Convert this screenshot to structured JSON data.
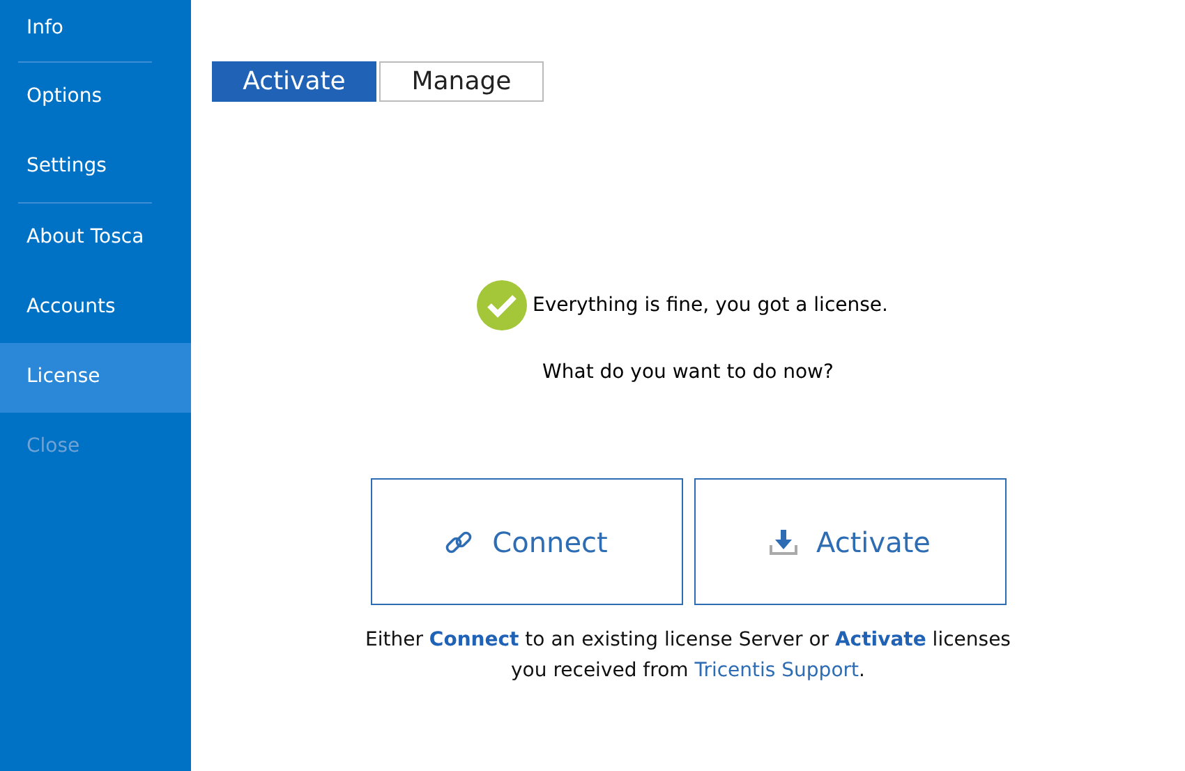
{
  "sidebar": {
    "items": [
      {
        "label": "Info",
        "selected": false,
        "disabled": false,
        "divider_after": true
      },
      {
        "label": "Options",
        "selected": false,
        "disabled": false,
        "divider_after": false
      },
      {
        "label": "Settings",
        "selected": false,
        "disabled": false,
        "divider_after": true
      },
      {
        "label": "About Tosca",
        "selected": false,
        "disabled": false,
        "divider_after": false
      },
      {
        "label": "Accounts",
        "selected": false,
        "disabled": false,
        "divider_after": false
      },
      {
        "label": "License",
        "selected": true,
        "disabled": false,
        "divider_after": false
      },
      {
        "label": "Close",
        "selected": false,
        "disabled": true,
        "divider_after": false
      }
    ]
  },
  "tabs": [
    {
      "label": "Activate",
      "selected": true
    },
    {
      "label": "Manage",
      "selected": false
    }
  ],
  "status": {
    "text": "Everything is fine, you got a license.",
    "ok": true
  },
  "question": "What do you want to do now?",
  "actions": [
    {
      "label": "Connect",
      "kind": "link"
    },
    {
      "label": "Activate",
      "kind": "download"
    }
  ],
  "footer": {
    "text": "Either **Connect** to an existing license Server or **Activate** licenses you received from",
    "link": "Tricentis Support",
    "tail": "."
  }
}
